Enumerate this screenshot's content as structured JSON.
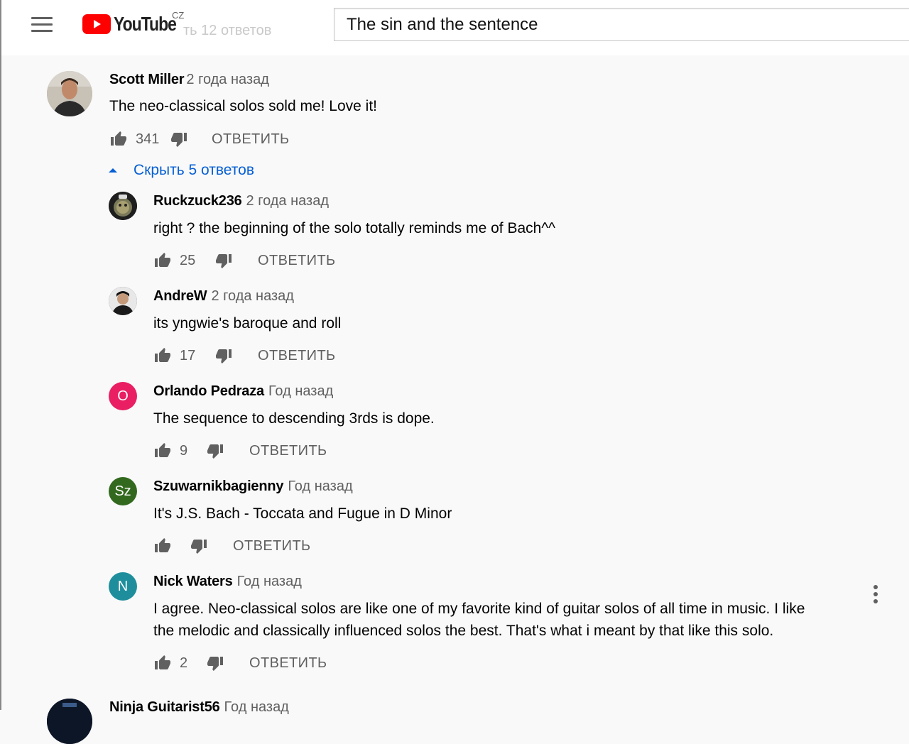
{
  "search": {
    "query": "The sin and the sentence"
  },
  "logo": {
    "text": "YouTube",
    "country": "CZ"
  },
  "ghost_text": {
    "line": "ть 12 ответов"
  },
  "labels": {
    "reply": "ОТВЕТИТЬ",
    "hide_replies": "Скрыть 5 ответов"
  },
  "comments": [
    {
      "author": "Scott Miller",
      "time": "2 года назад",
      "text": "The neo-classical solos sold me!  Love it!",
      "likes": "341"
    },
    {
      "author": "Ruckzuck236",
      "time": "2 года назад",
      "text": "right ? the beginning of the solo totally reminds me of Bach^^",
      "likes": "25"
    },
    {
      "author": "AndreW",
      "time": "2 года назад",
      "text": "its yngwie's baroque and roll",
      "likes": "17"
    },
    {
      "author": "Orlando Pedraza",
      "time": "Год назад",
      "text": "The sequence to descending 3rds is dope.",
      "likes": "9",
      "avatar_letter": "O",
      "avatar_color": "#e91e63"
    },
    {
      "author": "Szuwarnikbagienny",
      "time": "Год назад",
      "text": "It's J.S. Bach - Toccata and Fugue in D Minor",
      "likes": "",
      "avatar_letter": "Sz",
      "avatar_color": "#33691e"
    },
    {
      "author": "Nick Waters",
      "time": "Год назад",
      "text_line1": "I agree. Neo-classical solos are like one of my favorite kind of guitar solos of all time in music. I like",
      "text_line2": "the melodic and classically influenced solos the best. That's what i meant by that like this solo.",
      "likes": "2",
      "avatar_letter": "N",
      "avatar_color": "#1e8e9c"
    },
    {
      "author": "Ninja Guitarist56",
      "time": "Год назад"
    }
  ],
  "colors": {
    "link_blue": "#065fd4",
    "youtube_red": "#ff0000",
    "secondary_text": "#606060"
  }
}
